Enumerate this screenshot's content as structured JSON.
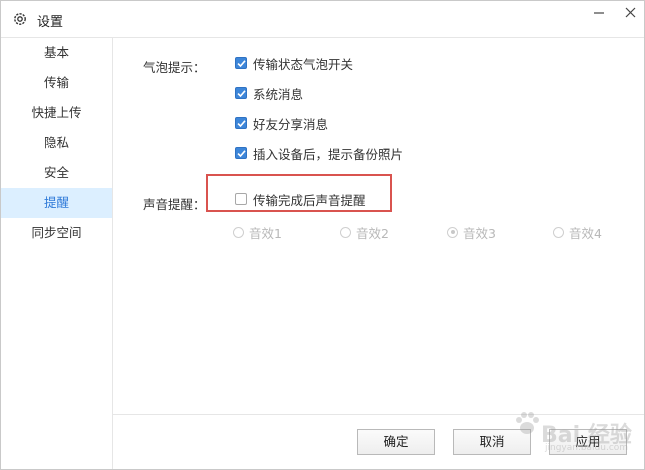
{
  "window": {
    "title": "设置"
  },
  "sidebar": {
    "items": [
      {
        "label": "基本",
        "active": false
      },
      {
        "label": "传输",
        "active": false
      },
      {
        "label": "快捷上传",
        "active": false
      },
      {
        "label": "隐私",
        "active": false
      },
      {
        "label": "安全",
        "active": false
      },
      {
        "label": "提醒",
        "active": true
      },
      {
        "label": "同步空间",
        "active": false
      }
    ]
  },
  "bubble": {
    "label": "气泡提示：",
    "options": [
      {
        "label": "传输状态气泡开关",
        "checked": true
      },
      {
        "label": "系统消息",
        "checked": true
      },
      {
        "label": "好友分享消息",
        "checked": true
      },
      {
        "label": "插入设备后，提示备份照片",
        "checked": true
      }
    ]
  },
  "sound": {
    "label": "声音提醒：",
    "option": {
      "label": "传输完成后声音提醒",
      "checked": false
    },
    "effects": [
      {
        "label": "音效1",
        "selected": false
      },
      {
        "label": "音效2",
        "selected": false
      },
      {
        "label": "音效3",
        "selected": true
      },
      {
        "label": "音效4",
        "selected": false
      }
    ]
  },
  "footer": {
    "ok": "确定",
    "cancel": "取消",
    "apply": "应用"
  },
  "watermark": {
    "text": "Bai 经验",
    "sub": "jingyan.baidu.com"
  },
  "colors": {
    "accent": "#3d86d9",
    "active_bg": "#dcefff",
    "highlight": "#d9534f"
  }
}
